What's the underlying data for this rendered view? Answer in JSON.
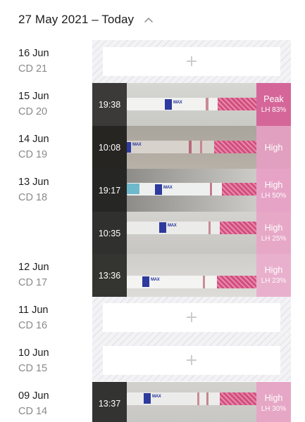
{
  "header": {
    "title": "27 May 2021 – Today",
    "chevron_icon": "chevron-up-icon"
  },
  "colors": {
    "peak": "#d5669a",
    "high": "#e6a3c6",
    "high_light": "#e9b0cd",
    "time_bg": "#2f2f2f"
  },
  "days": [
    {
      "date": "16 Jun",
      "cd": "CD 21",
      "tests": []
    },
    {
      "date": "15 Jun",
      "cd": "CD 20",
      "tests": [
        {
          "time": "19:38",
          "result": "Peak",
          "lh": "LH 83%"
        }
      ]
    },
    {
      "date": "14 Jun",
      "cd": "CD 19",
      "tests": [
        {
          "time": "10:08",
          "result": "High",
          "lh": ""
        }
      ]
    },
    {
      "date": "13 Jun",
      "cd": "CD 18",
      "tests": [
        {
          "time": "19:17",
          "result": "High",
          "lh": "LH 50%"
        },
        {
          "time": "10:35",
          "result": "High",
          "lh": "LH 25%"
        }
      ]
    },
    {
      "date": "12 Jun",
      "cd": "CD 17",
      "tests": [
        {
          "time": "13:36",
          "result": "High",
          "lh": "LH 23%"
        }
      ]
    },
    {
      "date": "11 Jun",
      "cd": "CD 16",
      "tests": []
    },
    {
      "date": "10 Jun",
      "cd": "CD 15",
      "tests": []
    },
    {
      "date": "09 Jun",
      "cd": "CD 14",
      "tests": [
        {
          "time": "13:37",
          "result": "High",
          "lh": "LH 30%"
        }
      ]
    }
  ],
  "strip_text": "MAX",
  "add_symbol": "+"
}
